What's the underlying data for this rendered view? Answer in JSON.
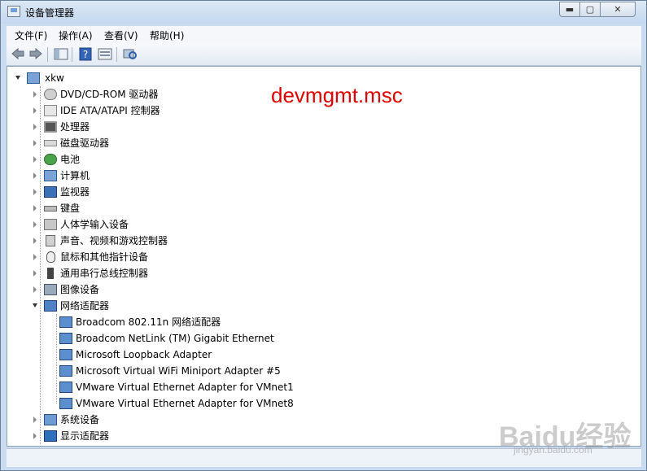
{
  "window": {
    "title": "设备管理器",
    "min_glyph": "▬",
    "max_glyph": "▢",
    "close_glyph": "✕"
  },
  "menu": [
    {
      "label": "文件(F)"
    },
    {
      "label": "操作(A)"
    },
    {
      "label": "查看(V)"
    },
    {
      "label": "帮助(H)"
    }
  ],
  "toolbar": {
    "icons": [
      "back-arrow-icon",
      "forward-arrow-icon",
      "show-hide-tree-icon",
      "help-icon",
      "properties-icon",
      "scan-hardware-icon"
    ]
  },
  "tree": {
    "root": {
      "label": "xkw",
      "icon": "computer-icon"
    },
    "categories": [
      {
        "label": "DVD/CD-ROM 驱动器",
        "icon": "disc-drive-icon",
        "expanded": false
      },
      {
        "label": "IDE ATA/ATAPI 控制器",
        "icon": "ide-controller-icon",
        "expanded": false
      },
      {
        "label": "处理器",
        "icon": "processor-icon",
        "expanded": false
      },
      {
        "label": "磁盘驱动器",
        "icon": "disk-drive-icon",
        "expanded": false
      },
      {
        "label": "电池",
        "icon": "battery-icon",
        "expanded": false
      },
      {
        "label": "计算机",
        "icon": "computer-category-icon",
        "expanded": false
      },
      {
        "label": "监视器",
        "icon": "monitor-icon",
        "expanded": false
      },
      {
        "label": "键盘",
        "icon": "keyboard-icon",
        "expanded": false
      },
      {
        "label": "人体学输入设备",
        "icon": "hid-icon",
        "expanded": false
      },
      {
        "label": "声音、视频和游戏控制器",
        "icon": "sound-icon",
        "expanded": false
      },
      {
        "label": "鼠标和其他指针设备",
        "icon": "mouse-icon",
        "expanded": false
      },
      {
        "label": "通用串行总线控制器",
        "icon": "usb-icon",
        "expanded": false
      },
      {
        "label": "图像设备",
        "icon": "camera-icon",
        "expanded": false
      },
      {
        "label": "网络适配器",
        "icon": "network-adapter-icon",
        "expanded": true
      }
    ],
    "network_children": [
      {
        "label": "Broadcom 802.11n 网络适配器"
      },
      {
        "label": "Broadcom NetLink (TM) Gigabit Ethernet"
      },
      {
        "label": "Microsoft Loopback Adapter"
      },
      {
        "label": "Microsoft Virtual WiFi Miniport Adapter #5"
      },
      {
        "label": "VMware Virtual Ethernet Adapter for VMnet1"
      },
      {
        "label": "VMware Virtual Ethernet Adapter for VMnet8"
      }
    ],
    "after": [
      {
        "label": "系统设备",
        "icon": "system-devices-icon",
        "expanded": false
      },
      {
        "label": "显示适配器",
        "icon": "display-adapter-icon",
        "expanded": false
      }
    ]
  },
  "annotation": "devmgmt.msc",
  "watermark": {
    "text": "Baidu经验",
    "sub": "jingyan.baidu.com"
  },
  "colors": {
    "annotation": "#e00000",
    "frame": "#c9dbee"
  }
}
